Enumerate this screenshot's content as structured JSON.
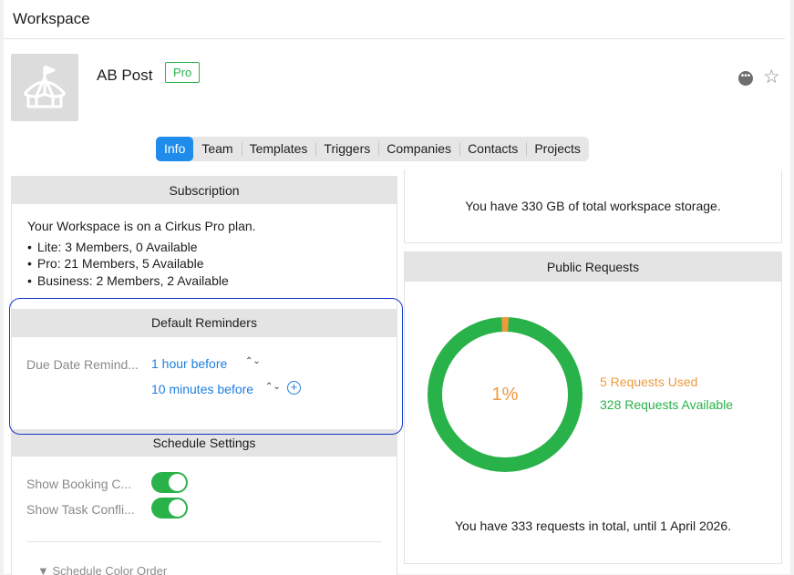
{
  "window": {
    "title": "Workspace"
  },
  "workspace": {
    "name": "AB Post",
    "plan_badge": "Pro",
    "icon": "circus-tent-icon"
  },
  "header_actions": {
    "more_icon": "ellipsis-icon",
    "more_glyph": "•••",
    "favorite_icon": "star-icon",
    "favorite_glyph": "☆"
  },
  "tabs": [
    {
      "label": "Info",
      "active": true
    },
    {
      "label": "Team"
    },
    {
      "label": "Templates"
    },
    {
      "label": "Triggers"
    },
    {
      "label": "Companies"
    },
    {
      "label": "Contacts"
    },
    {
      "label": "Projects"
    }
  ],
  "subscription": {
    "header": "Subscription",
    "summary": "Your Workspace is on a Cirkus Pro plan.",
    "items": [
      "Lite: 3 Members, 0 Available",
      "Pro: 21 Members, 5 Available",
      "Business: 2 Members, 2 Available"
    ]
  },
  "default_reminders": {
    "header": "Default Reminders",
    "label": "Due Date Remind...",
    "values": [
      "1 hour before",
      "10 minutes before"
    ],
    "chevron": "⌃⌄",
    "add_glyph": "+"
  },
  "schedule_settings": {
    "header": "Schedule Settings",
    "toggles": [
      {
        "label": "Show Booking C...",
        "on": true
      },
      {
        "label": "Show Task Confli...",
        "on": true
      }
    ],
    "color_order": "▼ Schedule Color Order"
  },
  "storage": {
    "text": "You have 330 GB of total workspace storage."
  },
  "public_requests": {
    "header": "Public Requests",
    "percent_label": "1%",
    "used_fraction": 0.015,
    "used_label": "5 Requests Used",
    "available_label": "328 Requests Available",
    "total_text": "You have 333 requests in total, until 1 April 2026.",
    "colors": {
      "used": "#f09a3e",
      "available": "#29b24a"
    }
  }
}
